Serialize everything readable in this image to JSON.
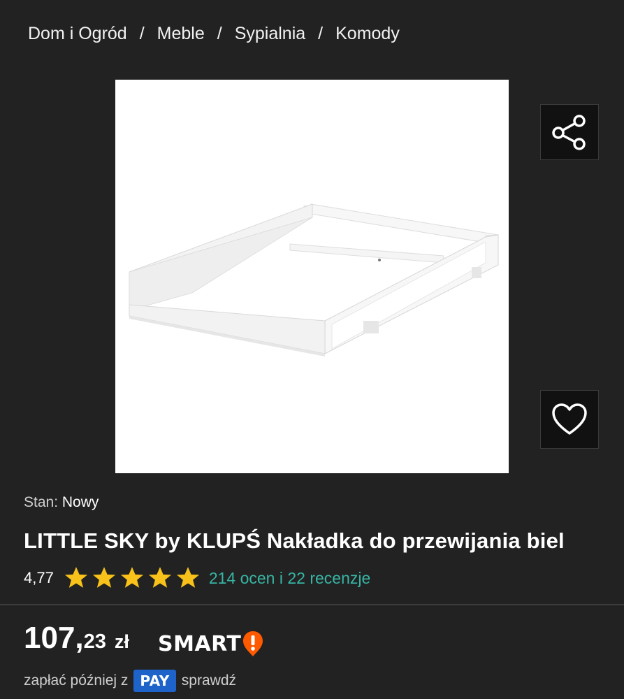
{
  "breadcrumb": {
    "items": [
      "Dom i Ogród",
      "Meble",
      "Sypialnia",
      "Komody"
    ],
    "separator": "/"
  },
  "product": {
    "image_alt": "LITTLE SKY by KLUPŚ Nakładka do przewijania biel",
    "condition_label": "Stan:",
    "condition_value": "Nowy",
    "title": "LITTLE SKY by KLUPŚ Nakładka do przewijania biel",
    "rating": {
      "score": "4,77",
      "stars": 5,
      "star_color": "#f9c21a",
      "reviews_text": "214 ocen i 22 recenzje",
      "reviews_color": "#37b5a4"
    }
  },
  "actions": {
    "share_icon": "share-icon",
    "favorite_icon": "heart-icon"
  },
  "price": {
    "main": "107,",
    "cents": "23",
    "currency": "zł",
    "badge_text": "SMART",
    "badge_icon": "exclamation-shield-icon",
    "badge_color": "#ff5a00"
  },
  "payment": {
    "prefix": "zapłać później z",
    "badge": "PAY",
    "link": "sprawdź"
  }
}
